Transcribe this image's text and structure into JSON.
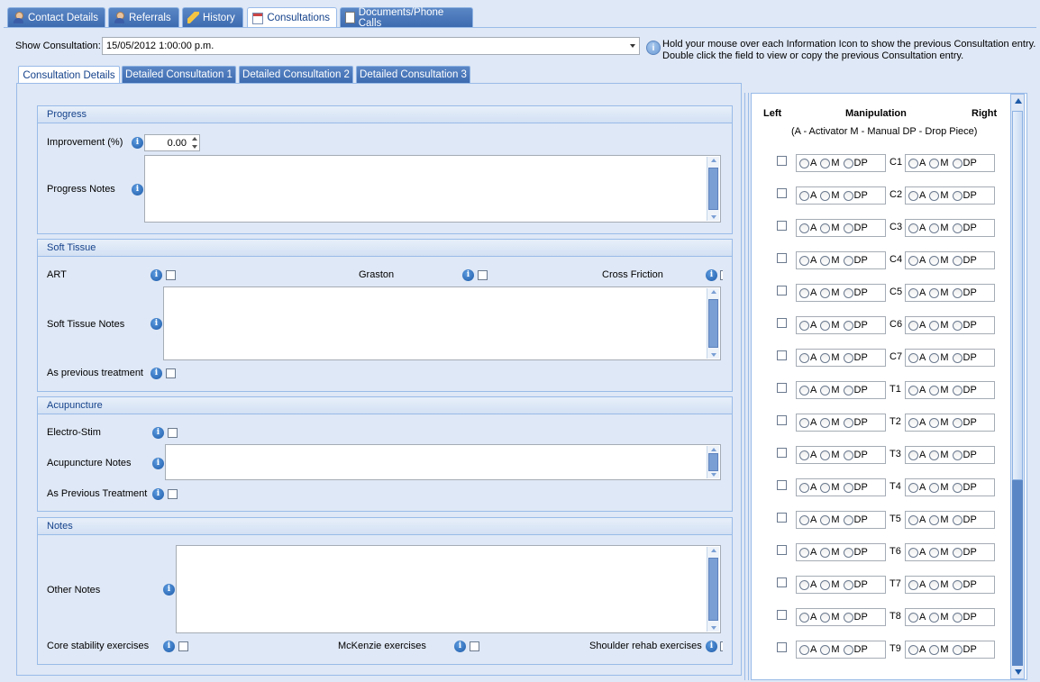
{
  "tabs": [
    {
      "label": "Contact Details",
      "icon": "person-icon"
    },
    {
      "label": "Referrals",
      "icon": "person-icon"
    },
    {
      "label": "History",
      "icon": "pencil-icon"
    },
    {
      "label": "Consultations",
      "icon": "calendar-icon"
    },
    {
      "label": "Documents/Phone Calls",
      "icon": "document-icon"
    }
  ],
  "active_tab": "Consultations",
  "show_consultation": {
    "label": "Show Consultation:",
    "value": "15/05/2012 1:00:00 p.m."
  },
  "hint": {
    "line1": "Hold your mouse over each Information Icon to show the previous Consultation entry.",
    "line2": "Double click the field to view or copy the previous Consultation entry."
  },
  "subtabs": [
    "Consultation Details",
    "Detailed Consultation 1",
    "Detailed Consultation 2",
    "Detailed Consultation 3"
  ],
  "progress": {
    "title": "Progress",
    "improvement_label": "Improvement (%)",
    "improvement_value": "0.00",
    "notes_label": "Progress Notes"
  },
  "soft_tissue": {
    "title": "Soft Tissue",
    "art": "ART",
    "graston": "Graston",
    "cross_friction": "Cross Friction",
    "notes_label": "Soft Tissue Notes",
    "as_previous": "As previous treatment"
  },
  "acupuncture": {
    "title": "Acupuncture",
    "electro": "Electro-Stim",
    "notes_label": "Acupuncture Notes",
    "as_previous": "As Previous Treatment"
  },
  "notes": {
    "title": "Notes",
    "other_label": "Other Notes",
    "core": "Core stability exercises",
    "mckenzie": "McKenzie exercises",
    "shoulder": "Shoulder rehab exercises"
  },
  "manipulation": {
    "left": "Left",
    "title": "Manipulation",
    "right": "Right",
    "legend": "(A - Activator M - Manual DP - Drop Piece)",
    "options": [
      "A",
      "M",
      "DP"
    ],
    "vertebrae": [
      "C1",
      "C2",
      "C3",
      "C4",
      "C5",
      "C6",
      "C7",
      "T1",
      "T2",
      "T3",
      "T4",
      "T5",
      "T6",
      "T7",
      "T8",
      "T9"
    ]
  },
  "colors": {
    "accent": "#15428b",
    "tab_blue": "#3d6bb0",
    "panel": "#dfe8f6"
  }
}
